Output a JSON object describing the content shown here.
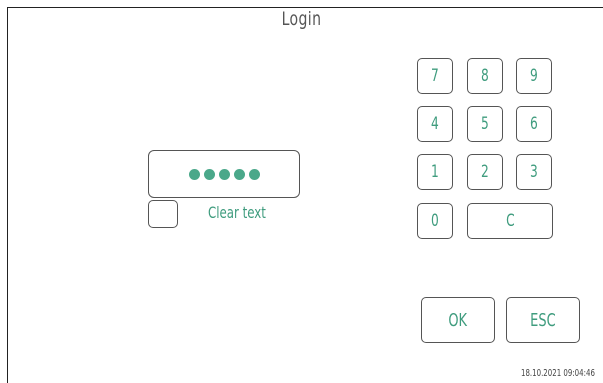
{
  "title": "Login",
  "password": {
    "masked_length": 5
  },
  "clear_text": {
    "label": "Clear text",
    "checked": false
  },
  "keypad": {
    "rows": [
      [
        "7",
        "8",
        "9"
      ],
      [
        "4",
        "5",
        "6"
      ],
      [
        "1",
        "2",
        "3"
      ]
    ],
    "zero": "0",
    "clear": "C"
  },
  "buttons": {
    "ok": "OK",
    "esc": "ESC"
  },
  "timestamp": "18.10.2021 09:04:46",
  "colors": {
    "accent": "#3f9c7e",
    "border": "#555555"
  }
}
